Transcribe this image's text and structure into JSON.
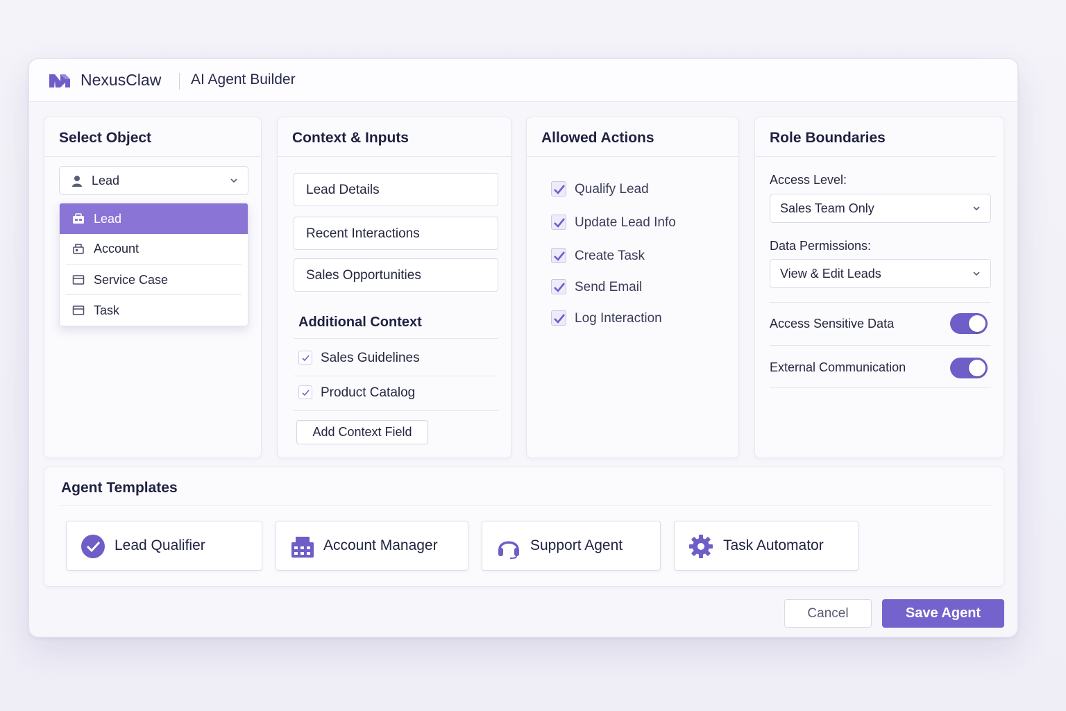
{
  "header": {
    "brand": "NexusClaw",
    "app_title": "AI Agent Builder"
  },
  "colors": {
    "accent": "#7463cc",
    "accent_light": "#8a74d6",
    "background": "#f4f3f9"
  },
  "select_object": {
    "title": "Select Object",
    "selected": "Lead",
    "selected_icon": "person-icon",
    "options": [
      {
        "label": "Lead",
        "icon": "lead-card-icon",
        "active": true
      },
      {
        "label": "Account",
        "icon": "account-icon",
        "active": false
      },
      {
        "label": "Service Case",
        "icon": "window-icon",
        "active": false
      },
      {
        "label": "Task",
        "icon": "window-icon",
        "active": false
      }
    ]
  },
  "context": {
    "title": "Context & Inputs",
    "inputs": [
      "Lead Details",
      "Recent Interactions",
      "Sales Opportunities"
    ],
    "additional_title": "Additional Context",
    "additional": [
      {
        "label": "Sales Guidelines",
        "checked": true
      },
      {
        "label": "Product Catalog",
        "checked": true
      }
    ],
    "add_button": "Add Context Field"
  },
  "actions": {
    "title": "Allowed Actions",
    "items": [
      {
        "label": "Qualify Lead",
        "checked": true
      },
      {
        "label": "Update Lead Info",
        "checked": true
      },
      {
        "label": "Create Task",
        "checked": true
      },
      {
        "label": "Send Email",
        "checked": true
      },
      {
        "label": "Log Interaction",
        "checked": true
      }
    ]
  },
  "role": {
    "title": "Role Boundaries",
    "access_label": "Access Level:",
    "access_value": "Sales Team Only",
    "perm_label": "Data Permissions:",
    "perm_value": "View & Edit Leads",
    "toggles": [
      {
        "label": "Access Sensitive Data",
        "on": true
      },
      {
        "label": "External Communication",
        "on": true
      }
    ]
  },
  "templates": {
    "title": "Agent Templates",
    "items": [
      {
        "label": "Lead Qualifier",
        "icon": "check-circle-icon"
      },
      {
        "label": "Account Manager",
        "icon": "building-icon"
      },
      {
        "label": "Support Agent",
        "icon": "headset-icon"
      },
      {
        "label": "Task Automator",
        "icon": "gear-icon"
      }
    ]
  },
  "footer": {
    "cancel": "Cancel",
    "save": "Save Agent"
  }
}
